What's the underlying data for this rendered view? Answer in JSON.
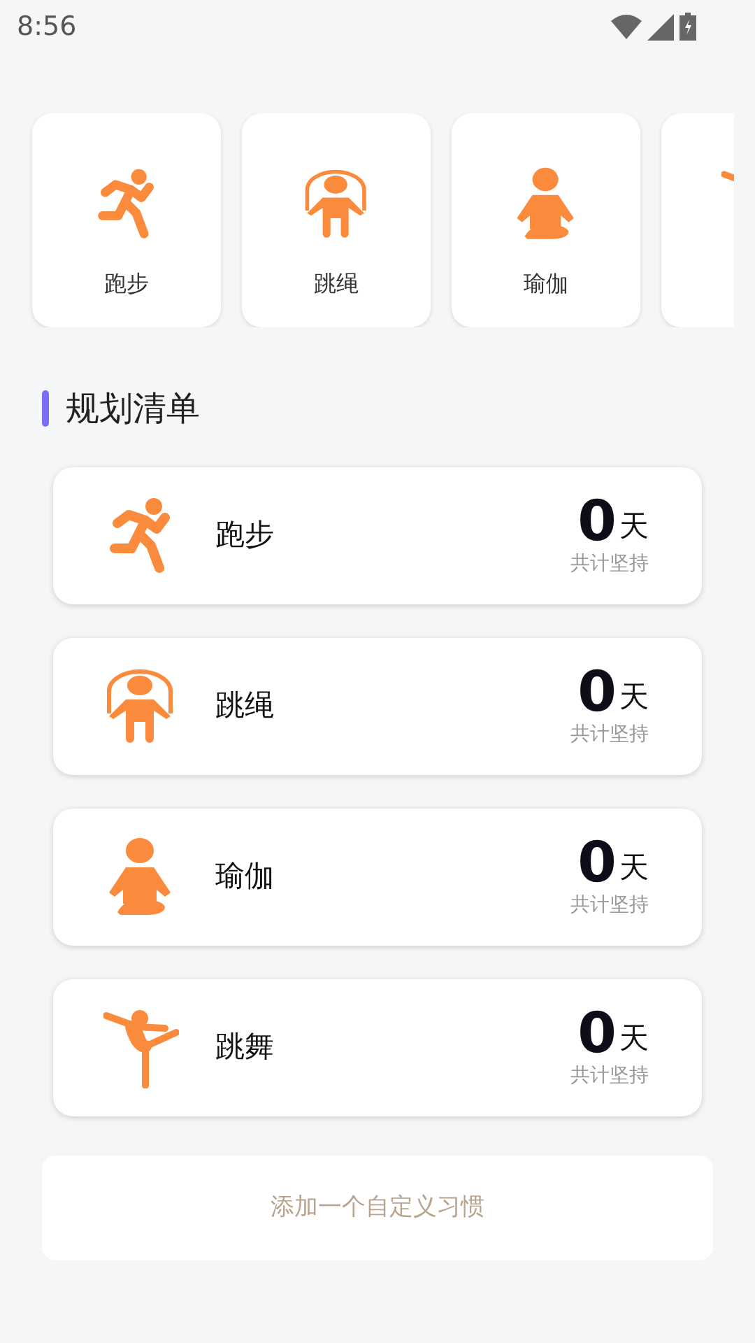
{
  "status_bar": {
    "time": "8:56"
  },
  "quick_habits": [
    {
      "kind": "run",
      "label": "跑步"
    },
    {
      "kind": "rope",
      "label": "跳绳"
    },
    {
      "kind": "yoga",
      "label": "瑜伽"
    },
    {
      "kind": "dance"
    }
  ],
  "section_title": "规划清单",
  "plan_list": [
    {
      "kind": "run",
      "name": "跑步",
      "days": "0",
      "unit": "天",
      "caption": "共计坚持"
    },
    {
      "kind": "rope",
      "name": "跳绳",
      "days": "0",
      "unit": "天",
      "caption": "共计坚持"
    },
    {
      "kind": "yoga",
      "name": "瑜伽",
      "days": "0",
      "unit": "天",
      "caption": "共计坚持"
    },
    {
      "kind": "dance",
      "name": "跳舞",
      "days": "0",
      "unit": "天",
      "caption": "共计坚持"
    }
  ],
  "add_button": "添加一个自定义习惯"
}
